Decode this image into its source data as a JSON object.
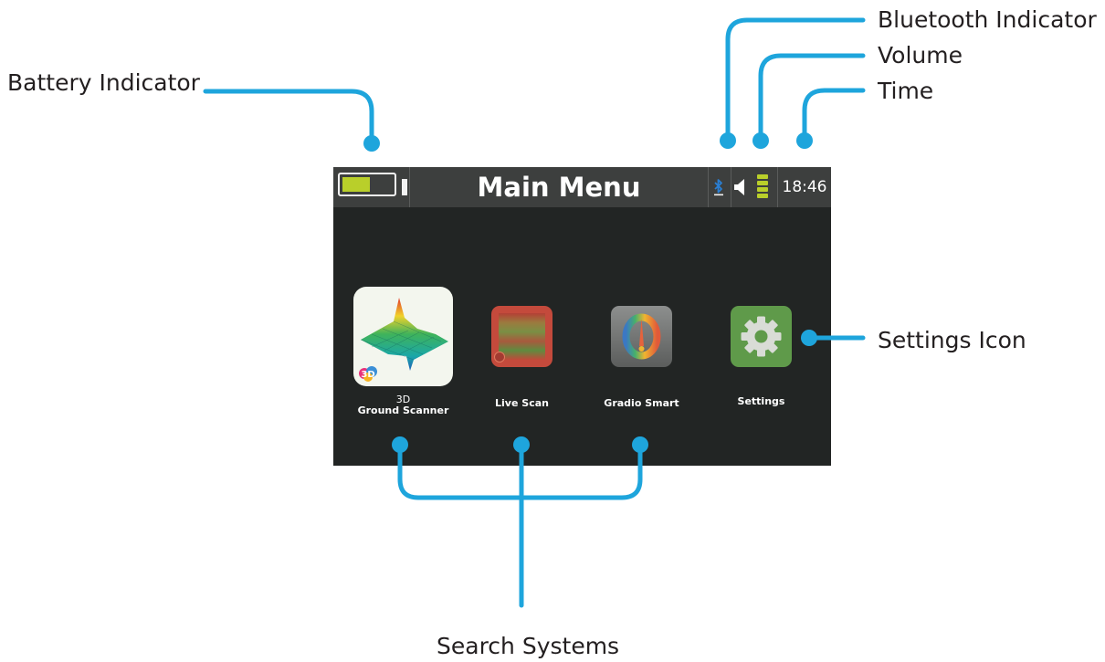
{
  "callouts": {
    "battery": "Battery Indicator",
    "bluetooth": "Bluetooth Indicator",
    "volume": "Volume",
    "time": "Time",
    "settings_icon": "Settings Icon",
    "search_systems": "Search Systems"
  },
  "screen": {
    "title": "Main Menu",
    "clock": "18:46",
    "battery_level": 0.55,
    "apps": [
      {
        "label_top": "3D",
        "label": "Ground Scanner",
        "icon": "3d-ground-scanner-icon"
      },
      {
        "label": "Live Scan",
        "icon": "live-scan-icon"
      },
      {
        "label": "Gradio Smart",
        "icon": "gradio-smart-icon"
      },
      {
        "label": "Settings",
        "icon": "gear-icon"
      }
    ],
    "icon_3d_badge": "3D"
  },
  "colors": {
    "connector": "#1ea5dc",
    "screen_bg": "#222524",
    "status_bar": "#3d3f3e",
    "battery_fill": "#b9cf2a"
  }
}
